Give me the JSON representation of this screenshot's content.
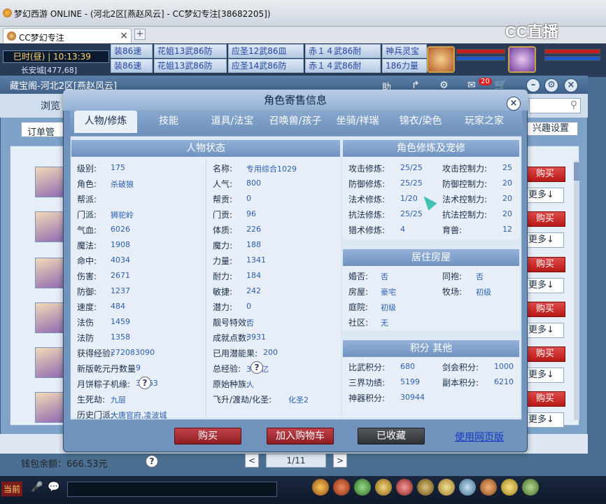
{
  "window": {
    "title": "梦幻西游 ONLINE - (河北2区[燕赵风云] - CC梦幻专注[38682205])"
  },
  "browser": {
    "tab_label": "CC梦幻专注",
    "close": "×",
    "new_tab": "+"
  },
  "cc": {
    "logo": "CC直播"
  },
  "game": {
    "clock_period": "巳时(昼)",
    "clock_time": "10:13:39",
    "location": "长安城[477,68]",
    "rank_top": [
      "装86速",
      "花姐13武86防",
      "应圣12武86皿",
      "赤１４武86耐",
      "神兵灵宝"
    ],
    "rank_bottom": [
      "装86速",
      "花姐13武86防",
      "应圣14武86防",
      "赤１４武86耐",
      "186力量"
    ]
  },
  "bg": {
    "title": "藏宝阁-河北2区[燕赵风云]",
    "browse": "浏览",
    "order_mgr": "订单管",
    "interest": "兴趣设置",
    "help": "助",
    "cart_count": "20",
    "buy_labels": [
      "购买",
      "购买",
      "购买",
      "购买",
      "购买",
      "购买"
    ],
    "more_labels": [
      "更多↓",
      "更多↓",
      "更多↓",
      "更多↓",
      "更多↓",
      "更多↓"
    ],
    "wallet": "钱包余额：666.53元",
    "page": "1/11",
    "prev": "<",
    "next": ">",
    "qm": "?"
  },
  "dialog": {
    "title": "角色寄售信息",
    "close": "×",
    "tabs": [
      "人物/修炼",
      "技能",
      "道具/法宝",
      "召唤兽/孩子",
      "坐骑/祥瑞",
      "锦衣/染色",
      "玩家之家"
    ],
    "status": {
      "header": "人物状态",
      "left": [
        [
          "级别:",
          "175"
        ],
        [
          "角色:",
          "杀破狼"
        ],
        [
          "帮派:",
          ""
        ],
        [
          "门派:",
          "狮驼岭"
        ],
        [
          "气血:",
          "6026"
        ],
        [
          "魔法:",
          "1908"
        ],
        [
          "命中:",
          "4034"
        ],
        [
          "伤害:",
          "2671"
        ],
        [
          "防御:",
          "1237"
        ],
        [
          "速度:",
          "484"
        ],
        [
          "法伤",
          "1459"
        ],
        [
          "法防",
          "1358"
        ],
        [
          "获得经验:",
          "272083090"
        ],
        [
          "新版乾元丹数量",
          "9"
        ],
        [
          "月饼粽子机缘:",
          "31/63"
        ],
        [
          "生死劫:",
          "九层"
        ],
        [
          "历史门派:",
          "大唐官府,凌波城"
        ]
      ],
      "right": [
        [
          "名称:",
          "专用综合1029"
        ],
        [
          "人气:",
          "800"
        ],
        [
          "帮贡:",
          "0"
        ],
        [
          "门贡:",
          "96"
        ],
        [
          "体质:",
          "226"
        ],
        [
          "魔力:",
          "188"
        ],
        [
          "力量:",
          "1341"
        ],
        [
          "耐力:",
          "184"
        ],
        [
          "敏捷:",
          "242"
        ],
        [
          "潜力:",
          "0"
        ],
        [
          "靓号特效:",
          "否"
        ],
        [
          "成就点数:",
          "3931"
        ],
        [
          "已用潜能果:",
          "200"
        ],
        [
          "总经验:",
          "347亿"
        ],
        [
          "原始种族:",
          "人"
        ],
        [
          "飞升/渡劫/化圣:",
          "化圣2"
        ]
      ]
    },
    "cultivation": {
      "header": "角色修炼及宠修",
      "left": [
        [
          "攻击修炼:",
          "25/25"
        ],
        [
          "防御修炼:",
          "25/25"
        ],
        [
          "法术修炼:",
          "1/20"
        ],
        [
          "抗法修炼:",
          "25/25"
        ],
        [
          "猎术修炼:",
          "4"
        ]
      ],
      "right": [
        [
          "攻击控制力:",
          "25"
        ],
        [
          "防御控制力:",
          "20"
        ],
        [
          "法术控制力:",
          "20"
        ],
        [
          "抗法控制力:",
          "20"
        ],
        [
          "育兽:",
          "12"
        ]
      ]
    },
    "house": {
      "header": "居住房屋",
      "left": [
        [
          "婚否:",
          "否"
        ],
        [
          "房屋:",
          "豪宅"
        ],
        [
          "庭院:",
          "初级"
        ],
        [
          "社区:",
          "无"
        ]
      ],
      "right": [
        [
          "同袍:",
          "否"
        ],
        [
          "牧场:",
          "初级"
        ]
      ]
    },
    "points": {
      "header": "积分 其他",
      "left": [
        [
          "比武积分:",
          "680"
        ],
        [
          "三界功绩:",
          "5199"
        ],
        [
          "神器积分:",
          "30944"
        ]
      ],
      "right": [
        [
          "剑会积分:",
          "1000"
        ],
        [
          "副本积分:",
          "6210"
        ]
      ]
    },
    "buttons": {
      "buy": "购买",
      "cart": "加入购物车",
      "fav": "已收藏",
      "web": "使用网页版"
    }
  },
  "taskbar": {
    "current": "当前"
  }
}
